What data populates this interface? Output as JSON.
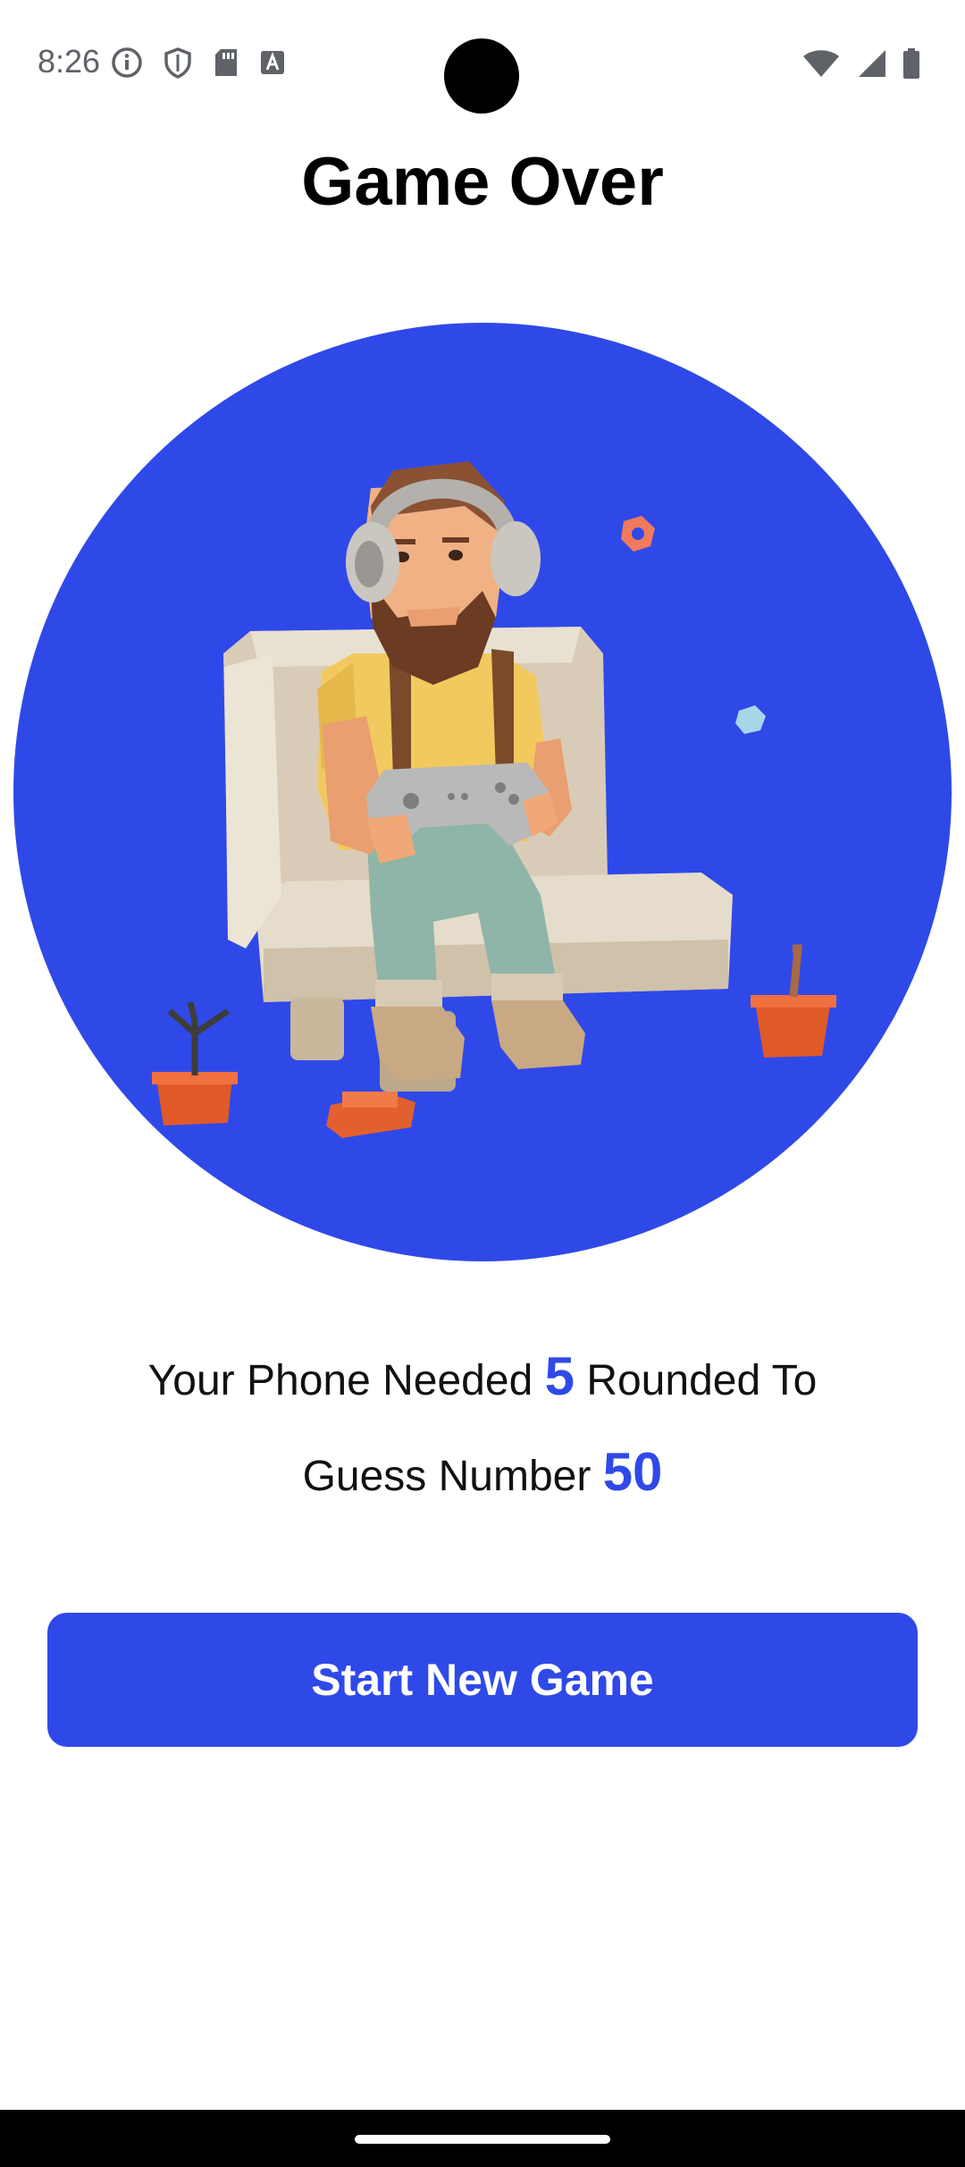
{
  "status_bar": {
    "time": "8:26",
    "left_icons": [
      "info-icon",
      "shield-icon",
      "sd-card-icon",
      "keyboard-a-icon"
    ],
    "right_icons": [
      "wifi-icon",
      "signal-icon",
      "battery-icon"
    ]
  },
  "header": {
    "title": "Game Over"
  },
  "hero": {
    "image": "gamer-on-couch-illustration",
    "background": "#2f49e8"
  },
  "result": {
    "line1_prefix": "Your Phone Needed ",
    "rounds": "5",
    "line1_suffix": " Rounded To",
    "line2_prefix": "Guess Number ",
    "number": "50"
  },
  "actions": {
    "start_label": "Start New Game"
  },
  "colors": {
    "accent": "#2f49e8",
    "text": "#111111",
    "background": "#ffffff"
  }
}
